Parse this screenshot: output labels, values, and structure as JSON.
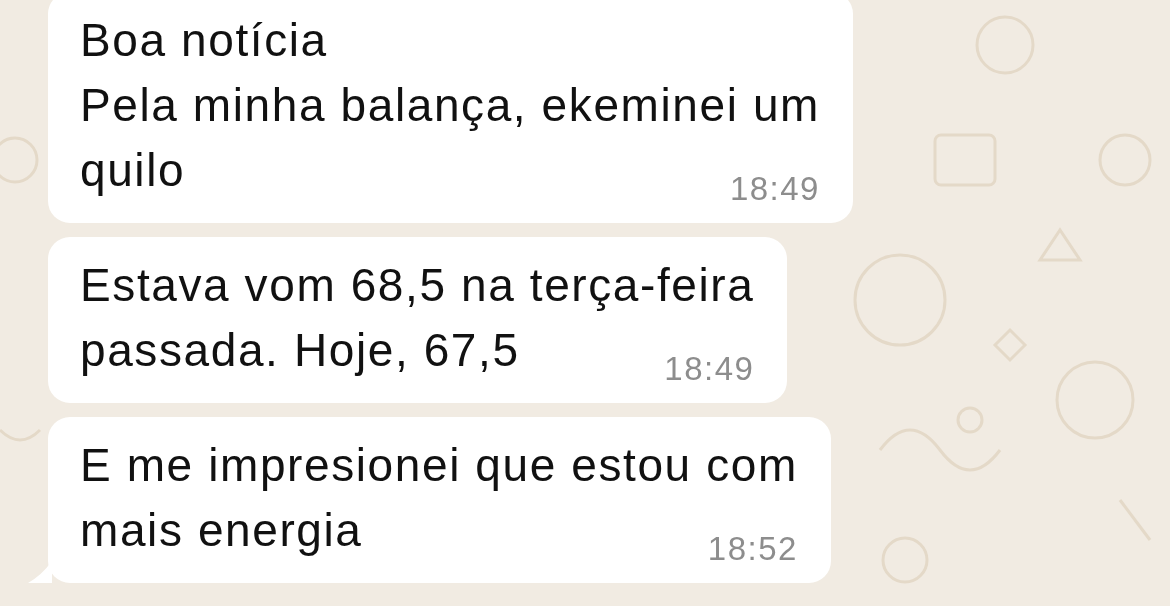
{
  "messages": [
    {
      "lines": [
        "Boa notícia",
        "Pela minha balança, ekeminei um",
        "quilo"
      ],
      "time": "18:49",
      "tail": false
    },
    {
      "lines": [
        "Estava vom 68,5 na terça-feira",
        "passada. Hoje, 67,5"
      ],
      "time": "18:49",
      "tail": false
    },
    {
      "lines": [
        "E me impresionei que estou com",
        "mais energia"
      ],
      "time": "18:52",
      "tail": true
    }
  ]
}
